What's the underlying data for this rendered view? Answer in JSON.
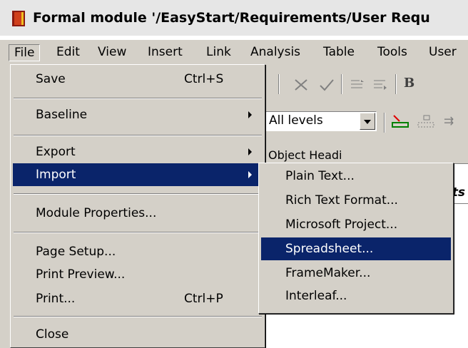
{
  "window": {
    "title": "Formal module '/EasyStart/Requirements/User Requ"
  },
  "menubar": {
    "items": [
      "File",
      "Edit",
      "View",
      "Insert",
      "Link",
      "Analysis",
      "Table",
      "Tools",
      "User"
    ]
  },
  "toolbar": {
    "levels_value": "All levels"
  },
  "grid": {
    "header": "Object Headi",
    "cell": "ts"
  },
  "file_menu": {
    "save": "Save",
    "save_shortcut": "Ctrl+S",
    "baseline": "Baseline",
    "export": "Export",
    "import": "Import",
    "module_properties": "Module Properties...",
    "page_setup": "Page Setup...",
    "print_preview": "Print Preview...",
    "print": "Print...",
    "print_shortcut": "Ctrl+P",
    "close": "Close"
  },
  "import_menu": {
    "items": [
      "Plain Text...",
      "Rich Text Format...",
      "Microsoft Project...",
      "Spreadsheet...",
      "FrameMaker...",
      "Interleaf..."
    ]
  },
  "colors": {
    "highlight": "#0a246a",
    "face": "#d4d0c8"
  },
  "icons": [
    "doors-app-icon",
    "cut-icon",
    "check-icon",
    "indent-left-icon",
    "indent-right-icon",
    "bold-icon",
    "link-toolbar-icon"
  ]
}
